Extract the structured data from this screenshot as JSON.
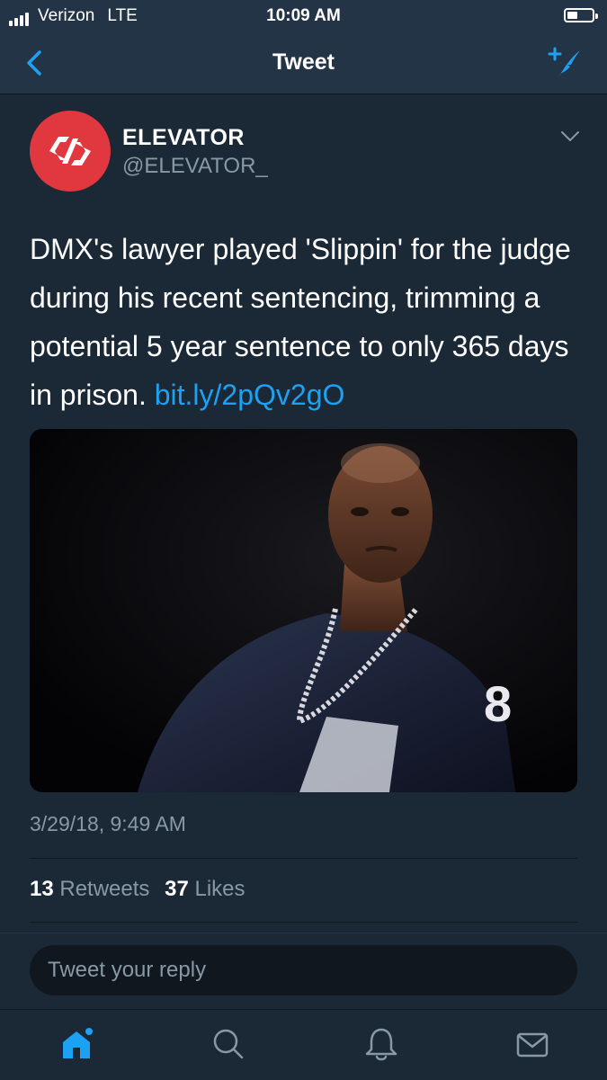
{
  "status_bar": {
    "carrier": "Verizon",
    "network": "LTE",
    "time": "10:09 AM"
  },
  "nav": {
    "title": "Tweet",
    "back_icon": "chevron-left-icon",
    "compose_icon": "compose-tweet-icon"
  },
  "tweet": {
    "author_name": "ELEVATOR",
    "author_handle": "@ELEVATOR_",
    "text": "DMX's lawyer played 'Slippin' for the judge during his recent sentencing, trimming a potential 5 year sentence to only 365 days in prison. ",
    "link": "bit.ly/2pQv2gO",
    "timestamp": "3/29/18, 9:49 AM",
    "retweets_count": "13",
    "retweets_label": "Retweets",
    "likes_count": "37",
    "likes_label": "Likes"
  },
  "reply": {
    "placeholder": "Tweet your reply"
  },
  "tabs": [
    {
      "icon": "home-icon",
      "active": true
    },
    {
      "icon": "search-icon",
      "active": false
    },
    {
      "icon": "notifications-bell-icon",
      "active": false
    },
    {
      "icon": "messages-envelope-icon",
      "active": false
    }
  ],
  "colors": {
    "background": "#141d26",
    "bar": "#243447",
    "card": "#1b2836",
    "accent": "#1da1f2",
    "secondary_text": "#8899a6",
    "avatar": "#e0383e"
  }
}
